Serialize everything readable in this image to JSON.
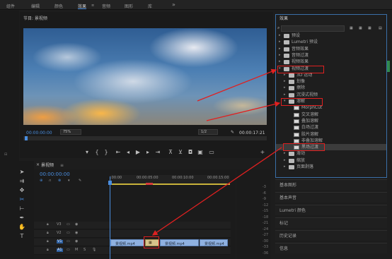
{
  "workspace_tabs": [
    "组件",
    "编辑",
    "颜色",
    "效果",
    "音频",
    "图形",
    "库"
  ],
  "workspace_more": "»",
  "monitor": {
    "title": "节目: 景视频",
    "timecode_left": "00:00:00:00",
    "zoom": "75%",
    "quality": "1/2",
    "timecode_right": "00:00:17:21"
  },
  "effects_panel": {
    "title": "效果",
    "items": [
      {
        "label": "预设",
        "type": "folder",
        "level": 0
      },
      {
        "label": "Lumetri 预设",
        "type": "folder",
        "level": 0
      },
      {
        "label": "音频效果",
        "type": "folder",
        "level": 0
      },
      {
        "label": "音频过渡",
        "type": "folder",
        "level": 0
      },
      {
        "label": "视频效果",
        "type": "folder",
        "level": 0
      },
      {
        "label": "视频过渡",
        "type": "folder",
        "level": 0,
        "expanded": true
      },
      {
        "label": "3D 运动",
        "type": "folder",
        "level": 1
      },
      {
        "label": "划像",
        "type": "folder",
        "level": 1
      },
      {
        "label": "擦除",
        "type": "folder",
        "level": 1
      },
      {
        "label": "沉浸式视频",
        "type": "folder",
        "level": 1
      },
      {
        "label": "溶解",
        "type": "folder",
        "level": 1,
        "expanded": true
      },
      {
        "label": "MorphCut",
        "type": "fx",
        "level": 2
      },
      {
        "label": "交叉溶解",
        "type": "fx",
        "level": 2
      },
      {
        "label": "叠加溶解",
        "type": "fx",
        "level": 2
      },
      {
        "label": "白场过渡",
        "type": "fx",
        "level": 2
      },
      {
        "label": "胶片溶解",
        "type": "fx",
        "level": 2
      },
      {
        "label": "非叠加溶解",
        "type": "fx",
        "level": 2
      },
      {
        "label": "黑场过渡",
        "type": "fx",
        "level": 2,
        "selected": true
      },
      {
        "label": "滑动",
        "type": "folder",
        "level": 1
      },
      {
        "label": "缩放",
        "type": "folder",
        "level": 1
      },
      {
        "label": "页面剥落",
        "type": "folder",
        "level": 1
      }
    ]
  },
  "lower_panels": [
    "基本图形",
    "基本声音",
    "Lumetri 颜色",
    "标记",
    "历史记录",
    "信息"
  ],
  "timeline": {
    "title": "景视频",
    "timecode": "00:00:00:00",
    "ruler": [
      ":00:00",
      "00:00:05:00",
      "00:00:10:00",
      "00:00:15:00"
    ],
    "tracks": [
      "V3",
      "V2",
      "V1",
      "A1"
    ],
    "clips": [
      "景视频.mp4",
      "景视频.mp4",
      "景视频.mp4"
    ]
  },
  "meter_labels": [
    "-3",
    "-6",
    "-9",
    "-12",
    "-15",
    "-18",
    "-21",
    "-24",
    "-27",
    "-30",
    "-33",
    "-36"
  ],
  "left_label": "2 项"
}
